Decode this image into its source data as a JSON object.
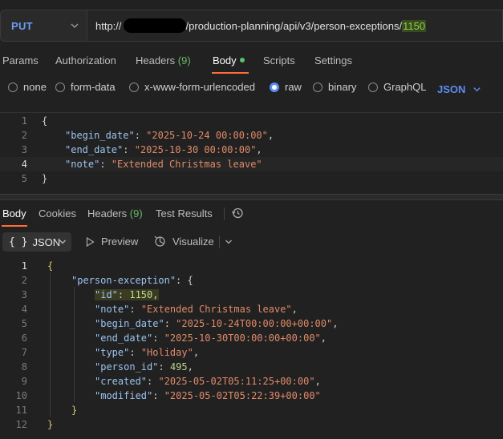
{
  "request": {
    "method": "PUT",
    "url_prefix": "http://",
    "url_path": "/production-planning/api/v3/person-exceptions/",
    "url_id": "1150"
  },
  "request_tabs": [
    {
      "label": "Params"
    },
    {
      "label": "Authorization"
    },
    {
      "label": "Headers",
      "count": "(9)"
    },
    {
      "label": "Body",
      "active": true
    },
    {
      "label": "Scripts"
    },
    {
      "label": "Settings"
    }
  ],
  "body_types": {
    "options": [
      "none",
      "form-data",
      "x-www-form-urlencoded",
      "raw",
      "binary",
      "GraphQL"
    ],
    "selected": "raw",
    "format": "JSON"
  },
  "request_body_lines": [
    {
      "n": "1",
      "t": "{"
    },
    {
      "n": "2",
      "key": "\"begin_date\"",
      "val": "\"2025-10-24 00:00:00\"",
      "end": ","
    },
    {
      "n": "3",
      "key": "\"end_date\"",
      "val": "\"2025-10-30 00:00:00\"",
      "end": ","
    },
    {
      "n": "4",
      "key": "\"note\"",
      "val": "\"Extended Christmas leave\"",
      "end": ""
    },
    {
      "n": "5",
      "t": "}"
    }
  ],
  "response_tabs": [
    {
      "label": "Body",
      "active": true
    },
    {
      "label": "Cookies"
    },
    {
      "label": "Headers",
      "count": "(9)"
    },
    {
      "label": "Test Results"
    }
  ],
  "response_toolbar": {
    "format_braces": "{ }",
    "format_label": "JSON",
    "preview_label": "Preview",
    "visualize_label": "Visualize"
  },
  "response_lines": {
    "n": [
      "1",
      "2",
      "3",
      "4",
      "5",
      "6",
      "7",
      "8",
      "9",
      "10",
      "11",
      "12"
    ],
    "open": "{",
    "root_key": "\"person-exception\"",
    "root_open": ": {",
    "fields": [
      {
        "key": "\"id\"",
        "sep": ": ",
        "val": "1150",
        "end": ",",
        "num": true
      },
      {
        "key": "\"note\"",
        "sep": ": ",
        "val": "\"Extended Christmas leave\"",
        "end": ","
      },
      {
        "key": "\"begin_date\"",
        "sep": ": ",
        "val": "\"2025-10-24T00:00:00+00:00\"",
        "end": ","
      },
      {
        "key": "\"end_date\"",
        "sep": ": ",
        "val": "\"2025-10-30T00:00:00+00:00\"",
        "end": ","
      },
      {
        "key": "\"type\"",
        "sep": ": ",
        "val": "\"Holiday\"",
        "end": ","
      },
      {
        "key": "\"person_id\"",
        "sep": ": ",
        "val": "495",
        "end": ",",
        "num": true
      },
      {
        "key": "\"created\"",
        "sep": ": ",
        "val": "\"2025-05-02T05:11:25+00:00\"",
        "end": ","
      },
      {
        "key": "\"modified\"",
        "sep": ": ",
        "val": "\"2025-05-02T05:22:39+00:00\"",
        "end": ""
      }
    ],
    "inner_close": "}",
    "close": "}"
  },
  "colors": {
    "accent": "#ff6c37",
    "method": "#6b9bf5",
    "json_key": "#9cc4ef",
    "json_string": "#e08a69",
    "json_number": "#bcd98b"
  }
}
